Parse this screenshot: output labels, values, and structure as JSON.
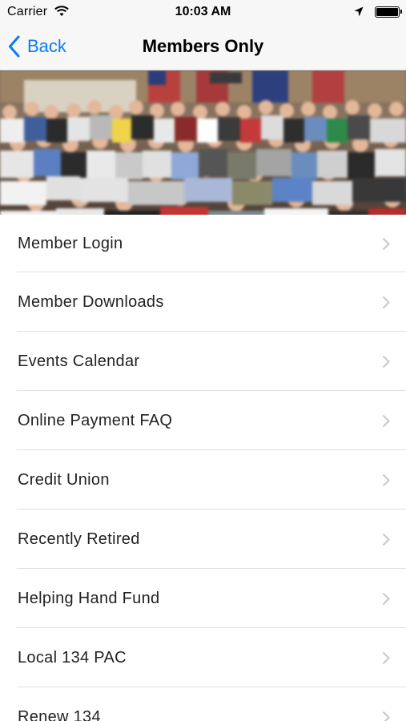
{
  "status_bar": {
    "carrier": "Carrier",
    "time": "10:03 AM",
    "icons": [
      "wifi-icon",
      "location-arrow-icon",
      "battery-icon"
    ]
  },
  "nav": {
    "back_label": "Back",
    "title": "Members Only",
    "accent_color": "#0a7cf7"
  },
  "hero": {
    "description_icon": "group-photo"
  },
  "menu": {
    "items": [
      {
        "label": "Member Login"
      },
      {
        "label": "Member Downloads"
      },
      {
        "label": "Events Calendar"
      },
      {
        "label": "Online Payment FAQ"
      },
      {
        "label": "Credit Union"
      },
      {
        "label": "Recently Retired"
      },
      {
        "label": "Helping Hand Fund"
      },
      {
        "label": "Local 134 PAC"
      },
      {
        "label": "Renew 134"
      }
    ]
  }
}
